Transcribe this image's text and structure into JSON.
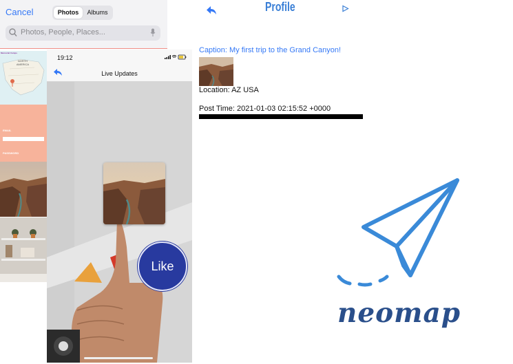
{
  "picker": {
    "cancel_label": "Cancel",
    "tabs": [
      "Photos",
      "Albums"
    ],
    "search_placeholder": "Photos, People, Places..."
  },
  "thumbnails": {
    "map_title": "Memorial Camps",
    "map_text": "NORTH AMERICA",
    "form_labels": [
      "EMAIL",
      "PASSWORD"
    ]
  },
  "phone": {
    "time": "19:12",
    "title": "Live Updates",
    "like_label": "Like"
  },
  "profile": {
    "title": "Profile",
    "caption": "Caption: My first trip to the Grand Canyon!",
    "location": "Location: AZ USA",
    "post_time": "Post Time: 2021-01-03 02:15:52 +0000"
  },
  "logo": {
    "wordmark": "neomap"
  },
  "colors": {
    "ios_blue": "#3478f6",
    "like_button": "#283a9f",
    "logo_blue": "#3a8ad8",
    "wordmark": "#2a4f8b",
    "form_salmon": "#f7b39b"
  },
  "icons": [
    "search-icon",
    "mic-icon",
    "back-arrow-icon",
    "play-icon",
    "paper-plane-icon",
    "signal-icon",
    "wifi-icon",
    "battery-icon"
  ]
}
